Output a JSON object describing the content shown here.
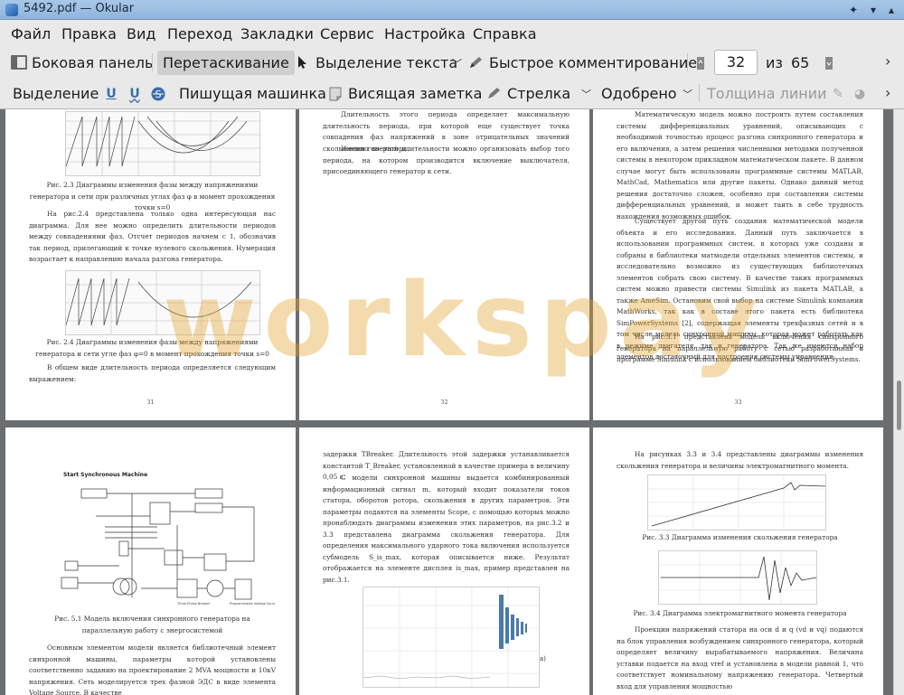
{
  "window": {
    "title": "5492.pdf — Okular"
  },
  "menu": [
    "Файл",
    "Правка",
    "Вид",
    "Переход",
    "Закладки",
    "Сервис",
    "Настройка",
    "Справка"
  ],
  "toolbar1": {
    "sidebar": "Боковая панель",
    "drag": "Перетаскивание",
    "text_select": "Выделение текста",
    "quick_comment": "Быстрое комментирование",
    "page_current": "32",
    "page_of": "из",
    "page_total": "65"
  },
  "toolbar2": {
    "highlight": "Выделение",
    "typewriter": "Пишущая машинка",
    "sticky_note": "Висящая заметка",
    "arrow": "Стрелка",
    "stamp": "Одобрено",
    "line_width": "Толщина линии"
  },
  "watermark": "workspay",
  "pages": {
    "p31": {
      "cap1": "Рис. 2.3 Диаграммы изменения фазы между напряжениями генератора и сети при различных углах фаз φ в момент прохождения точки s=0",
      "para1": "На рис.2.4 представлена только одна интересующая нас диаграмма. Для нее можно определить длительности периодов между совпадениями фаз. Отсчет периодов начнем с 1, обозначив так период, прилегающий к точке нулевого скольжения. Нумерация возрастает к направлению начала разгона генератора.",
      "cap2": "Рис. 2.4 Диаграммы изменения фазы между напряжениями генератора и сети угле фаз φ=0 в момент прохождения точки s=0",
      "para2": "В общем виде длительность периода определяется следующим выражением:",
      "num": "31"
    },
    "p32": {
      "para1": "Длительность этого периода определяет максимальную длительность периода, при которой еще существует точка совпадения фаз напряжений в зоне отрицательных значений скольжения генератора.",
      "para2": "Именно во этой длительности можно организовать выбор того периода, на котором производится включение выключателя, присоединяющего генератор к сети.",
      "num": "32"
    },
    "p33": {
      "para1": "Математическую модель можно построить путем составления системы дифференциальных уравнений, описывающих с необходимой точностью процесс разгона синхронного генератора и его включения, а затем решения численными методами полученной системы в некотором прикладном математическом пакете. В данном случае могут быть использованы программные системы MATLAB, MathCad, Mathematica или другие пакеты. Однако данный метод решения достаточно сложен, особенно при составлении системы дифференциальных уравнений, и может таить в себе трудность нахождения возможных ошибок.",
      "para2": "Существует другой путь создания математической модели объекта и его исследования. Данный путь заключается в использовании программных систем, в которых уже созданы и собраны в библиотеки матмодели отдельных элементов системы, и исследовательно возможно из существующих библиотечных элементов собрать свою систему. В качестве таких программных систем можно привести системы Simulink из пакета MATLAB, а также AmeSim. Остановим свой выбор на системе Simulink компании MathWorks, так как в составе этого пакета есть библиотека SimPowerSystems [2], содержащая элементы трехфазных сетей и в том числе модель синхронной машины, которая может работать как в режиме двигателя, так и генератора. Так же имеются набор элементов достаточный для построения системы управления.",
      "para3": "На рис.3.1 представлена модель включения синхронного генератора на параллельную работу с сетью разработанная в программе Simulink с использованием библиотеки SimPowerSystems.",
      "num": "33"
    },
    "p34": {
      "diagram_title": "Start Synchronous Machine",
      "cap1": "Рис. 5.1 Модель включения синхронного генератора на параллельную работу с энергосистемой",
      "para1": "Основным элементом модели является библиотечный элемент синхронной машины, параметры которой установлены соответственно заданию на проектирование 2 MVA мощности и 10кV напряжения. Сеть моделируется трех фазной ЭДС в виде элемента Voltage Source. В качестве"
    },
    "p35": {
      "para1": "задержки TBreaker. Длительность этой задержки устанавливается константой T_Breaker, установленной в качестве примера в величину 0,05 с.",
      "para2": "С модели синхронной машины выдается комбинированный информационный сигнал m, который входит показатели токов статора, оборотов ротора, скольжения в других параметров. Эти параметры подаются на элементы Scope, с помощью которых можно пронаблюдать диаграммы изменения этих параметров, на рис.3.2 и 3.3 представлена диаграмма скольжения генератора. Для определения максимального ударного тока включения используется субмодель S_is_max, которая описывается ниже. Результат отображается на элементе дисплея is_max, пример представлен на рис.3.1.",
      "fig_label": "а)"
    },
    "p36": {
      "para1": "На рисунках 3.3 и 3.4 представлены диаграммы изменения скольжения генератора и величины электромагнитного момента.",
      "cap1": "Рис. 3.3 Диаграмма изменения скольжения генератора",
      "cap2": "Рис. 3.4 Диаграмма электромагнитного момента генератора",
      "para2": "Проекции напряжений статора на оси d и q (vd и vq) подаются на блок управления возбуждением синхронного генератора, который определяет величину вырабатываемого напряжения. Величина уставки подается на вход vref и установлена в модели равной 1, что соответствует номинальному напряжению генератора. Четвертый вход для управления мощностью"
    }
  }
}
